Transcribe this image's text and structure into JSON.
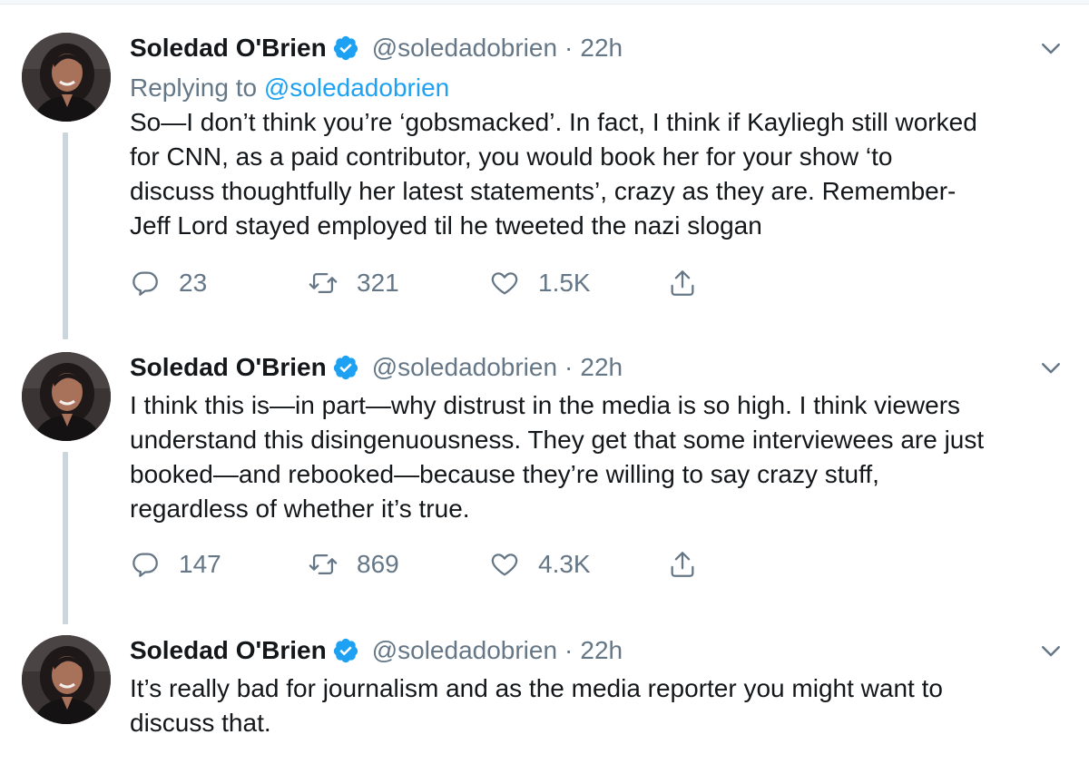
{
  "tweets": [
    {
      "name": "Soledad O'Brien",
      "handle": "@soledadobrien",
      "separator": "·",
      "time": "22h",
      "replying_prefix": "Replying to ",
      "replying_handle": "@soledadobrien",
      "text": "So—I don’t think you’re ‘gobsmacked’. In fact,  I think if Kayliegh still worked\nfor CNN, as a paid contributor, you would book her for your show ‘to\ndiscuss thoughtfully her latest statements’, crazy as they are. Remember-\nJeff Lord stayed employed til he tweeted the nazi slogan",
      "replies": "23",
      "retweets": "321",
      "likes": "1.5K"
    },
    {
      "name": "Soledad O'Brien",
      "handle": "@soledadobrien",
      "separator": "·",
      "time": "22h",
      "text": "I think this is—in part—why distrust in the media is so high. I think viewers\nunderstand this disingenuousness. They get that some interviewees are just\nbooked—and rebooked—because they’re willing to say crazy stuff,\nregardless of whether it’s true.",
      "replies": "147",
      "retweets": "869",
      "likes": "4.3K"
    },
    {
      "name": "Soledad O'Brien",
      "handle": "@soledadobrien",
      "separator": "·",
      "time": "22h",
      "text": "It’s really bad for journalism and as the media reporter you might want to\ndiscuss that."
    }
  ],
  "icons": {
    "verified": "verified-badge-icon",
    "caret": "chevron-down-icon",
    "reply": "reply-icon",
    "retweet": "retweet-icon",
    "like": "heart-icon",
    "share": "share-icon"
  },
  "colors": {
    "text": "#14171a",
    "secondary": "#657786",
    "accent": "#1da1f2",
    "thread_line": "#ccd6dd"
  }
}
